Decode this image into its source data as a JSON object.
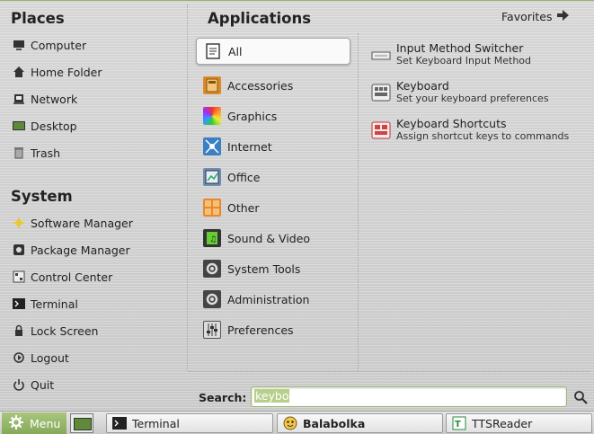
{
  "places": {
    "heading": "Places",
    "items": [
      {
        "label": "Computer",
        "icon": "computer-icon"
      },
      {
        "label": "Home Folder",
        "icon": "home-icon"
      },
      {
        "label": "Network",
        "icon": "network-icon"
      },
      {
        "label": "Desktop",
        "icon": "desktop-icon"
      },
      {
        "label": "Trash",
        "icon": "trash-icon"
      }
    ]
  },
  "system": {
    "heading": "System",
    "items": [
      {
        "label": "Software Manager",
        "icon": "star-icon"
      },
      {
        "label": "Package Manager",
        "icon": "package-icon"
      },
      {
        "label": "Control Center",
        "icon": "control-center-icon"
      },
      {
        "label": "Terminal",
        "icon": "terminal-icon"
      },
      {
        "label": "Lock Screen",
        "icon": "lock-icon"
      },
      {
        "label": "Logout",
        "icon": "logout-icon"
      },
      {
        "label": "Quit",
        "icon": "power-icon"
      }
    ]
  },
  "applications": {
    "heading": "Applications",
    "favorites_label": "Favorites",
    "categories": [
      {
        "label": "All",
        "icon": "all-icon",
        "active": true
      },
      {
        "label": "Accessories",
        "icon": "accessories-icon"
      },
      {
        "label": "Graphics",
        "icon": "graphics-icon"
      },
      {
        "label": "Internet",
        "icon": "internet-icon"
      },
      {
        "label": "Office",
        "icon": "office-icon"
      },
      {
        "label": "Other",
        "icon": "other-icon"
      },
      {
        "label": "Sound & Video",
        "icon": "sound-video-icon"
      },
      {
        "label": "System Tools",
        "icon": "system-tools-icon"
      },
      {
        "label": "Administration",
        "icon": "administration-icon"
      },
      {
        "label": "Preferences",
        "icon": "preferences-icon"
      }
    ],
    "results": [
      {
        "name": "Input Method Switcher",
        "desc": "Set Keyboard Input Method",
        "icon": "keyboard-small-icon"
      },
      {
        "name": "Keyboard",
        "desc": "Set your keyboard preferences",
        "icon": "keyboard-icon"
      },
      {
        "name": "Keyboard Shortcuts",
        "desc": "Assign shortcut keys to commands",
        "icon": "keyboard-shortcuts-icon"
      }
    ]
  },
  "search": {
    "label": "Search:",
    "value": "keybo"
  },
  "panel": {
    "menu_label": "Menu",
    "tasks": [
      {
        "label": "Terminal",
        "icon": "terminal-icon"
      },
      {
        "label": "Balabolka",
        "icon": "balabolka-icon"
      },
      {
        "label": "TTSReader",
        "icon": "ttsreader-icon"
      }
    ]
  },
  "colors": {
    "accent": "#8fb366",
    "search_highlight": "#b6cf8a"
  }
}
